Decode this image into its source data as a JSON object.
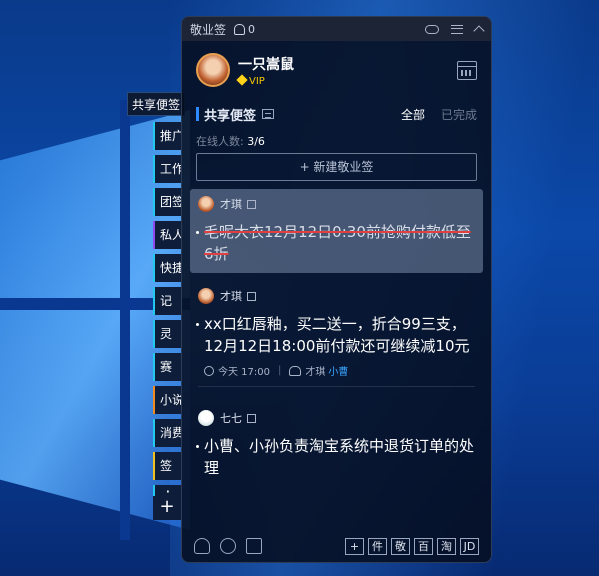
{
  "side": {
    "header": "共享便签",
    "tabs": [
      "推广",
      "工作",
      "团签",
      "私人",
      "快捷",
      "记",
      "灵",
      "赛",
      "小说",
      "消费",
      "签"
    ],
    "more": "⋮",
    "add": "+"
  },
  "panel": {
    "title": "敬业签",
    "notify_count": "0",
    "user": {
      "name": "一只嵩鼠",
      "badge": "VIP"
    },
    "section_title": "共享便签",
    "filters": {
      "all": "全部",
      "done": "已完成"
    },
    "online": {
      "label": "在线人数: ",
      "value": "3/6"
    },
    "new_button": "+ 新建敬业签",
    "notes": [
      {
        "author": "才琪",
        "text": "毛呢大衣12月12日0:30前抢购付款低至6折",
        "done": true
      },
      {
        "author": "才琪",
        "text": "xx口红唇釉，买二送一，折合99三支，12月12日18:00前付款还可继续减10元",
        "time": "今天 17:00",
        "assignee": "才琪",
        "assignee2": "小曹"
      },
      {
        "author": "七七",
        "text": "小曹、小孙负责淘宝系统中退货订单的处理"
      }
    ],
    "bottom": {
      "buttons": [
        "+",
        "件",
        "敬",
        "百",
        "淘",
        "JD"
      ]
    }
  }
}
